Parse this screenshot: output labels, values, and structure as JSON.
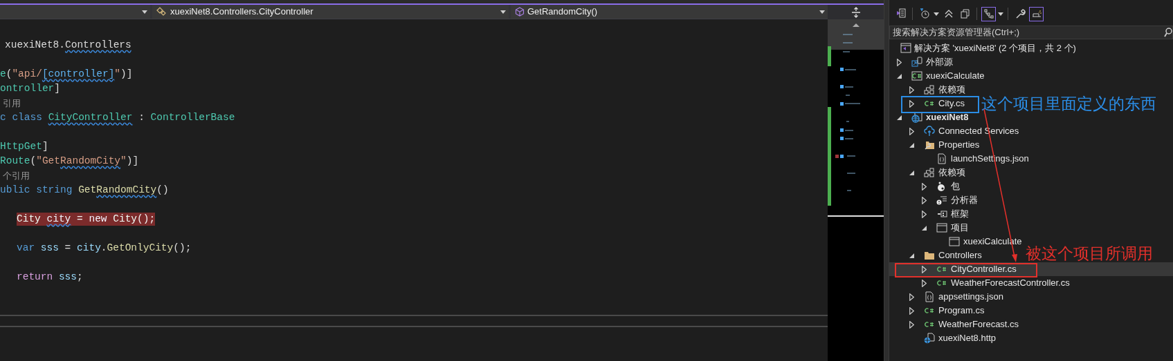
{
  "nav_bar": {
    "dropdowns": [
      {
        "kind": "class",
        "text": "xuexiNet8.Controllers.CityController"
      },
      {
        "kind": "method",
        "text": "GetRandomCity()"
      }
    ]
  },
  "code_lines": [
    {
      "kind": "namespace",
      "highlighted": false,
      "tokens": [
        {
          "text": "xuexiNet8.",
          "kind": "plain"
        },
        {
          "text": "Controllers",
          "kind": "plain",
          "squiggle": true
        }
      ]
    },
    {
      "kind": "blank"
    },
    {
      "kind": "member",
      "highlighted": false,
      "tokens": [
        {
          "text": "e",
          "kind": "type"
        },
        {
          "text": "(",
          "kind": "plain"
        },
        {
          "text": "\"api/",
          "kind": "string"
        },
        {
          "text": "[controller]",
          "kind": "template",
          "squiggle": true
        },
        {
          "text": "\"",
          "kind": "string"
        },
        {
          "text": ")]",
          "kind": "plain"
        }
      ]
    },
    {
      "kind": "member",
      "highlighted": false,
      "tokens": [
        {
          "text": "ontroller",
          "kind": "type"
        },
        {
          "text": "]",
          "kind": "plain"
        }
      ]
    },
    {
      "kind": "codelens",
      "text": "引用"
    },
    {
      "kind": "member",
      "highlighted": false,
      "tokens": [
        {
          "text": "c ",
          "kind": "keyword"
        },
        {
          "text": "class ",
          "kind": "keyword"
        },
        {
          "text": "CityController",
          "kind": "type",
          "squiggle": true
        },
        {
          "text": " : ",
          "kind": "plain"
        },
        {
          "text": "ControllerBase",
          "kind": "type"
        }
      ]
    },
    {
      "kind": "blank"
    },
    {
      "kind": "member",
      "highlighted": false,
      "tokens": [
        {
          "text": "HttpGet",
          "kind": "type"
        },
        {
          "text": "]",
          "kind": "plain"
        }
      ]
    },
    {
      "kind": "member",
      "highlighted": false,
      "tokens": [
        {
          "text": "Route",
          "kind": "type"
        },
        {
          "text": "(",
          "kind": "plain"
        },
        {
          "text": "\"Get",
          "kind": "string"
        },
        {
          "text": "RandomCity",
          "kind": "string",
          "squiggle": true
        },
        {
          "text": "\"",
          "kind": "string"
        },
        {
          "text": ")]",
          "kind": "plain"
        }
      ]
    },
    {
      "kind": "codelens",
      "text": "个引用"
    },
    {
      "kind": "member",
      "highlighted": false,
      "tokens": [
        {
          "text": "ublic ",
          "kind": "keyword"
        },
        {
          "text": "string ",
          "kind": "keyword"
        },
        {
          "text": "Get",
          "kind": "method"
        },
        {
          "text": "RandomCity",
          "kind": "method",
          "squiggle": true
        },
        {
          "text": "()",
          "kind": "plain"
        }
      ]
    },
    {
      "kind": "blank"
    },
    {
      "kind": "statement",
      "highlighted": true,
      "tokens": [
        {
          "text": "City ",
          "kind": "type"
        },
        {
          "text": "city",
          "kind": "variable",
          "squiggle": true
        },
        {
          "text": " = ",
          "kind": "plain"
        },
        {
          "text": "new ",
          "kind": "keyword"
        },
        {
          "text": "City",
          "kind": "type"
        },
        {
          "text": "();",
          "kind": "plain"
        }
      ]
    },
    {
      "kind": "blank"
    },
    {
      "kind": "statement",
      "highlighted": false,
      "tokens": [
        {
          "text": "var ",
          "kind": "keyword"
        },
        {
          "text": "sss",
          "kind": "variable"
        },
        {
          "text": " = ",
          "kind": "plain"
        },
        {
          "text": "city",
          "kind": "variable"
        },
        {
          "text": ".",
          "kind": "plain"
        },
        {
          "text": "GetOnlyCity",
          "kind": "method"
        },
        {
          "text": "();",
          "kind": "plain"
        }
      ]
    },
    {
      "kind": "blank"
    },
    {
      "kind": "statement",
      "highlighted": false,
      "tokens": [
        {
          "text": "return ",
          "kind": "control"
        },
        {
          "text": "sss",
          "kind": "variable"
        },
        {
          "text": ";",
          "kind": "plain"
        }
      ]
    }
  ],
  "toolbar": [
    {
      "kind": "home",
      "on": false
    },
    {
      "kind": "separator"
    },
    {
      "kind": "pending",
      "on": false,
      "menu": true
    },
    {
      "kind": "collapse",
      "on": false
    },
    {
      "kind": "views",
      "on": false
    },
    {
      "kind": "separator"
    },
    {
      "kind": "filter",
      "on": true,
      "menu": true
    },
    {
      "kind": "separator"
    },
    {
      "kind": "properties",
      "on": false
    },
    {
      "kind": "preview",
      "on": true
    }
  ],
  "search": {
    "placeholder": "搜索解决方案资源管理器(Ctrl+;)"
  },
  "solution": {
    "label": "解决方案 'xuexiNet8' (2 个项目，共 2 个)"
  },
  "tree": [
    {
      "label": "外部源",
      "kind": "external",
      "expanded": false,
      "selected": false
    },
    {
      "label": "xuexiCalculate",
      "kind": "csproj",
      "expanded": true,
      "startup": false,
      "selected": false,
      "children": [
        {
          "label": "依赖项",
          "kind": "dependencies",
          "expanded": false,
          "selected": false
        },
        {
          "label": "City.cs",
          "kind": "csfile",
          "expanded": false,
          "selected": false
        }
      ]
    },
    {
      "label": "xuexiNet8",
      "kind": "webproj",
      "expanded": true,
      "startup": true,
      "selected": false,
      "children": [
        {
          "label": "Connected Services",
          "kind": "service",
          "expanded": false,
          "selected": false
        },
        {
          "label": "Properties",
          "kind": "properties",
          "expanded": true,
          "selected": false,
          "children": [
            {
              "label": "launchSettings.json",
              "kind": "json",
              "selected": false
            }
          ]
        },
        {
          "label": "依赖项",
          "kind": "dependencies",
          "expanded": true,
          "selected": false,
          "children": [
            {
              "label": "包",
              "kind": "package",
              "expanded": false,
              "selected": false
            },
            {
              "label": "分析器",
              "kind": "analyzer",
              "expanded": false,
              "selected": false
            },
            {
              "label": "框架",
              "kind": "framework",
              "expanded": false,
              "selected": false
            },
            {
              "label": "项目",
              "kind": "reference",
              "expanded": true,
              "selected": false,
              "children": [
                {
                  "label": "xuexiCalculate",
                  "kind": "reference",
                  "selected": false
                }
              ]
            }
          ]
        },
        {
          "label": "Controllers",
          "kind": "folder",
          "expanded": true,
          "selected": false,
          "children": [
            {
              "label": "CityController.cs",
              "kind": "csfile",
              "expanded": false,
              "selected": true
            },
            {
              "label": "WeatherForecastController.cs",
              "kind": "csfile",
              "expanded": false,
              "selected": false
            }
          ]
        },
        {
          "label": "appsettings.json",
          "kind": "json",
          "expanded": false,
          "selected": false
        },
        {
          "label": "Program.cs",
          "kind": "csfile",
          "expanded": false,
          "selected": false
        },
        {
          "label": "WeatherForecast.cs",
          "kind": "csfile",
          "expanded": false,
          "selected": false
        },
        {
          "label": "xuexiNet8.http",
          "kind": "http",
          "selected": false
        }
      ]
    }
  ],
  "annotations": [
    {
      "text": "这个项目里面定义的东西",
      "color": "#2b8de6"
    },
    {
      "text": "被这个项目所调用",
      "color": "#e3302b"
    }
  ]
}
